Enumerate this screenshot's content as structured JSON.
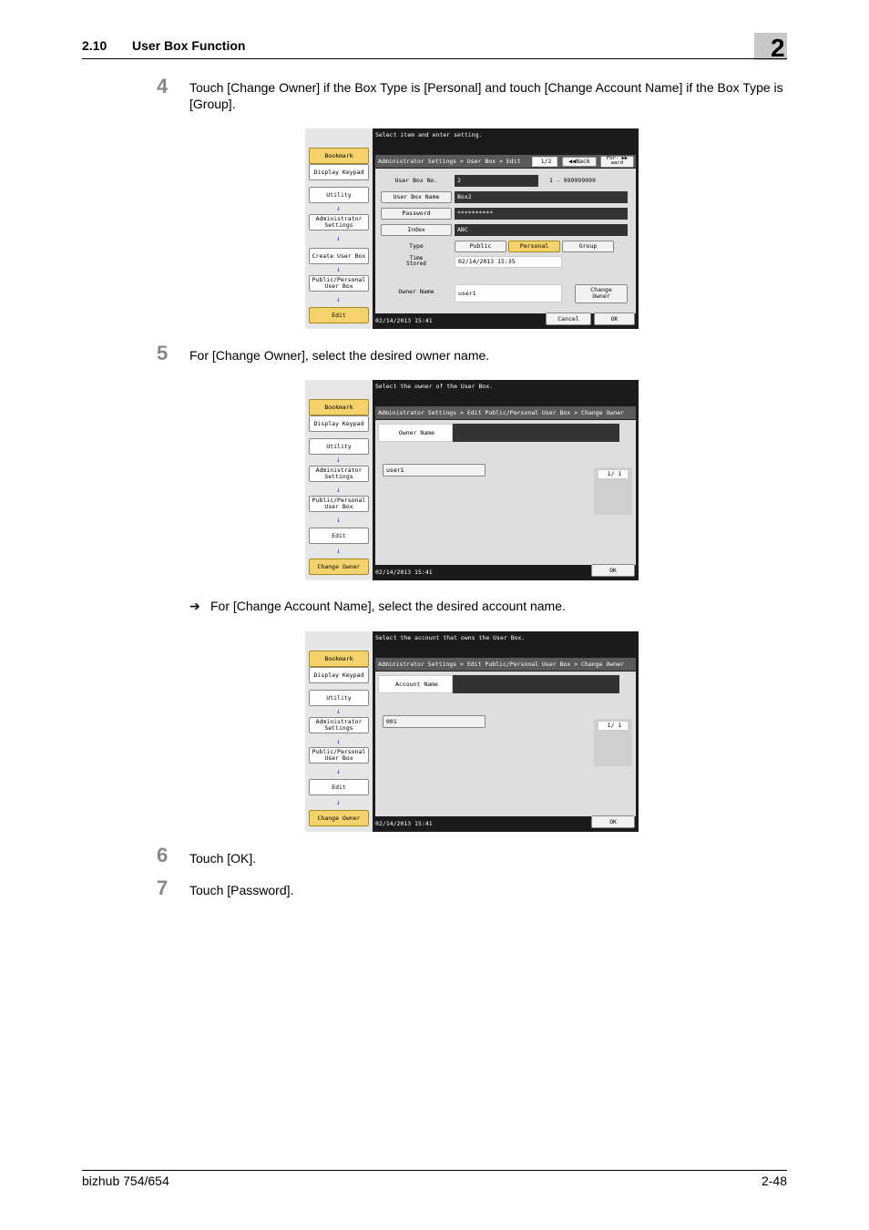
{
  "header": {
    "section": "2.10",
    "title": "User Box Function",
    "chapter": "2"
  },
  "steps": [
    {
      "num": "4",
      "text": "Touch [Change Owner] if the Box Type is [Personal] and touch [Change Account Name] if the Box Type is [Group]."
    },
    {
      "num": "5",
      "text": "For [Change Owner], select the desired owner name."
    },
    {
      "num": "6",
      "text": "Touch [OK]."
    },
    {
      "num": "7",
      "text": "Touch [Password]."
    }
  ],
  "substep": {
    "arrow": "➔",
    "text": "For [Change Account Name], select the desired account name."
  },
  "sidebar": {
    "bookmark": "Bookmark",
    "display_keypad": "Display Keypad",
    "utility": "Utility",
    "admin1": "Administrator",
    "admin2": "Settings",
    "create_box": "Create User Box",
    "pp1": "Public/Personal",
    "pp2": "User Box",
    "edit": "Edit",
    "change_owner": "Change Owner",
    "arrow": "↓"
  },
  "screen1": {
    "title": "Select item and enter setting.",
    "breadcrumb": "Administrator Settings > User Box > Edit",
    "page": "1/2",
    "back": "◀◀Back",
    "fwd1": "For-",
    "fwd2": "ward",
    "fwd_arrow": "▶▶",
    "box_no_label": "User Box No.",
    "box_no": "2",
    "range": "1 - 999999999",
    "box_name_label": "User Box Name",
    "box_name": "Box2",
    "password_label": "Password",
    "password": "**********",
    "index_label": "Index",
    "index": "ABC",
    "type_label": "Type",
    "type_public": "Public",
    "type_personal": "Personal",
    "type_group": "Group",
    "time_label1": "Time",
    "time_label2": "Stored",
    "time_stored": "02/14/2013   15:35",
    "owner_label": "Owner Name",
    "owner": "user1",
    "change_owner1": "Change",
    "change_owner2": "Owner",
    "datetime": "02/14/2013   15:41",
    "cancel": "Cancel",
    "ok": "OK"
  },
  "screen2": {
    "title": "Select the owner of the User Box.",
    "breadcrumb": "Administrator Settings > Edit Public/Personal User Box > Change Owner",
    "field_label": "Owner Name",
    "item": "user1",
    "page": "1/  1",
    "datetime": "02/14/2013   15:41",
    "ok": "OK"
  },
  "screen3": {
    "title": "Select the account that owns the User Box.",
    "breadcrumb": "Administrator Settings > Edit Public/Personal User Box > Change Owner",
    "field_label": "Account Name",
    "item": "001",
    "page": "1/  1",
    "datetime": "02/14/2013   15:41",
    "ok": "OK"
  },
  "footer": {
    "product": "bizhub 754/654",
    "page": "2-48"
  },
  "colors": {
    "highlight": "#f4d36c",
    "arrow_blue": "#1f4fd1",
    "dark": "#1b1b1b"
  }
}
